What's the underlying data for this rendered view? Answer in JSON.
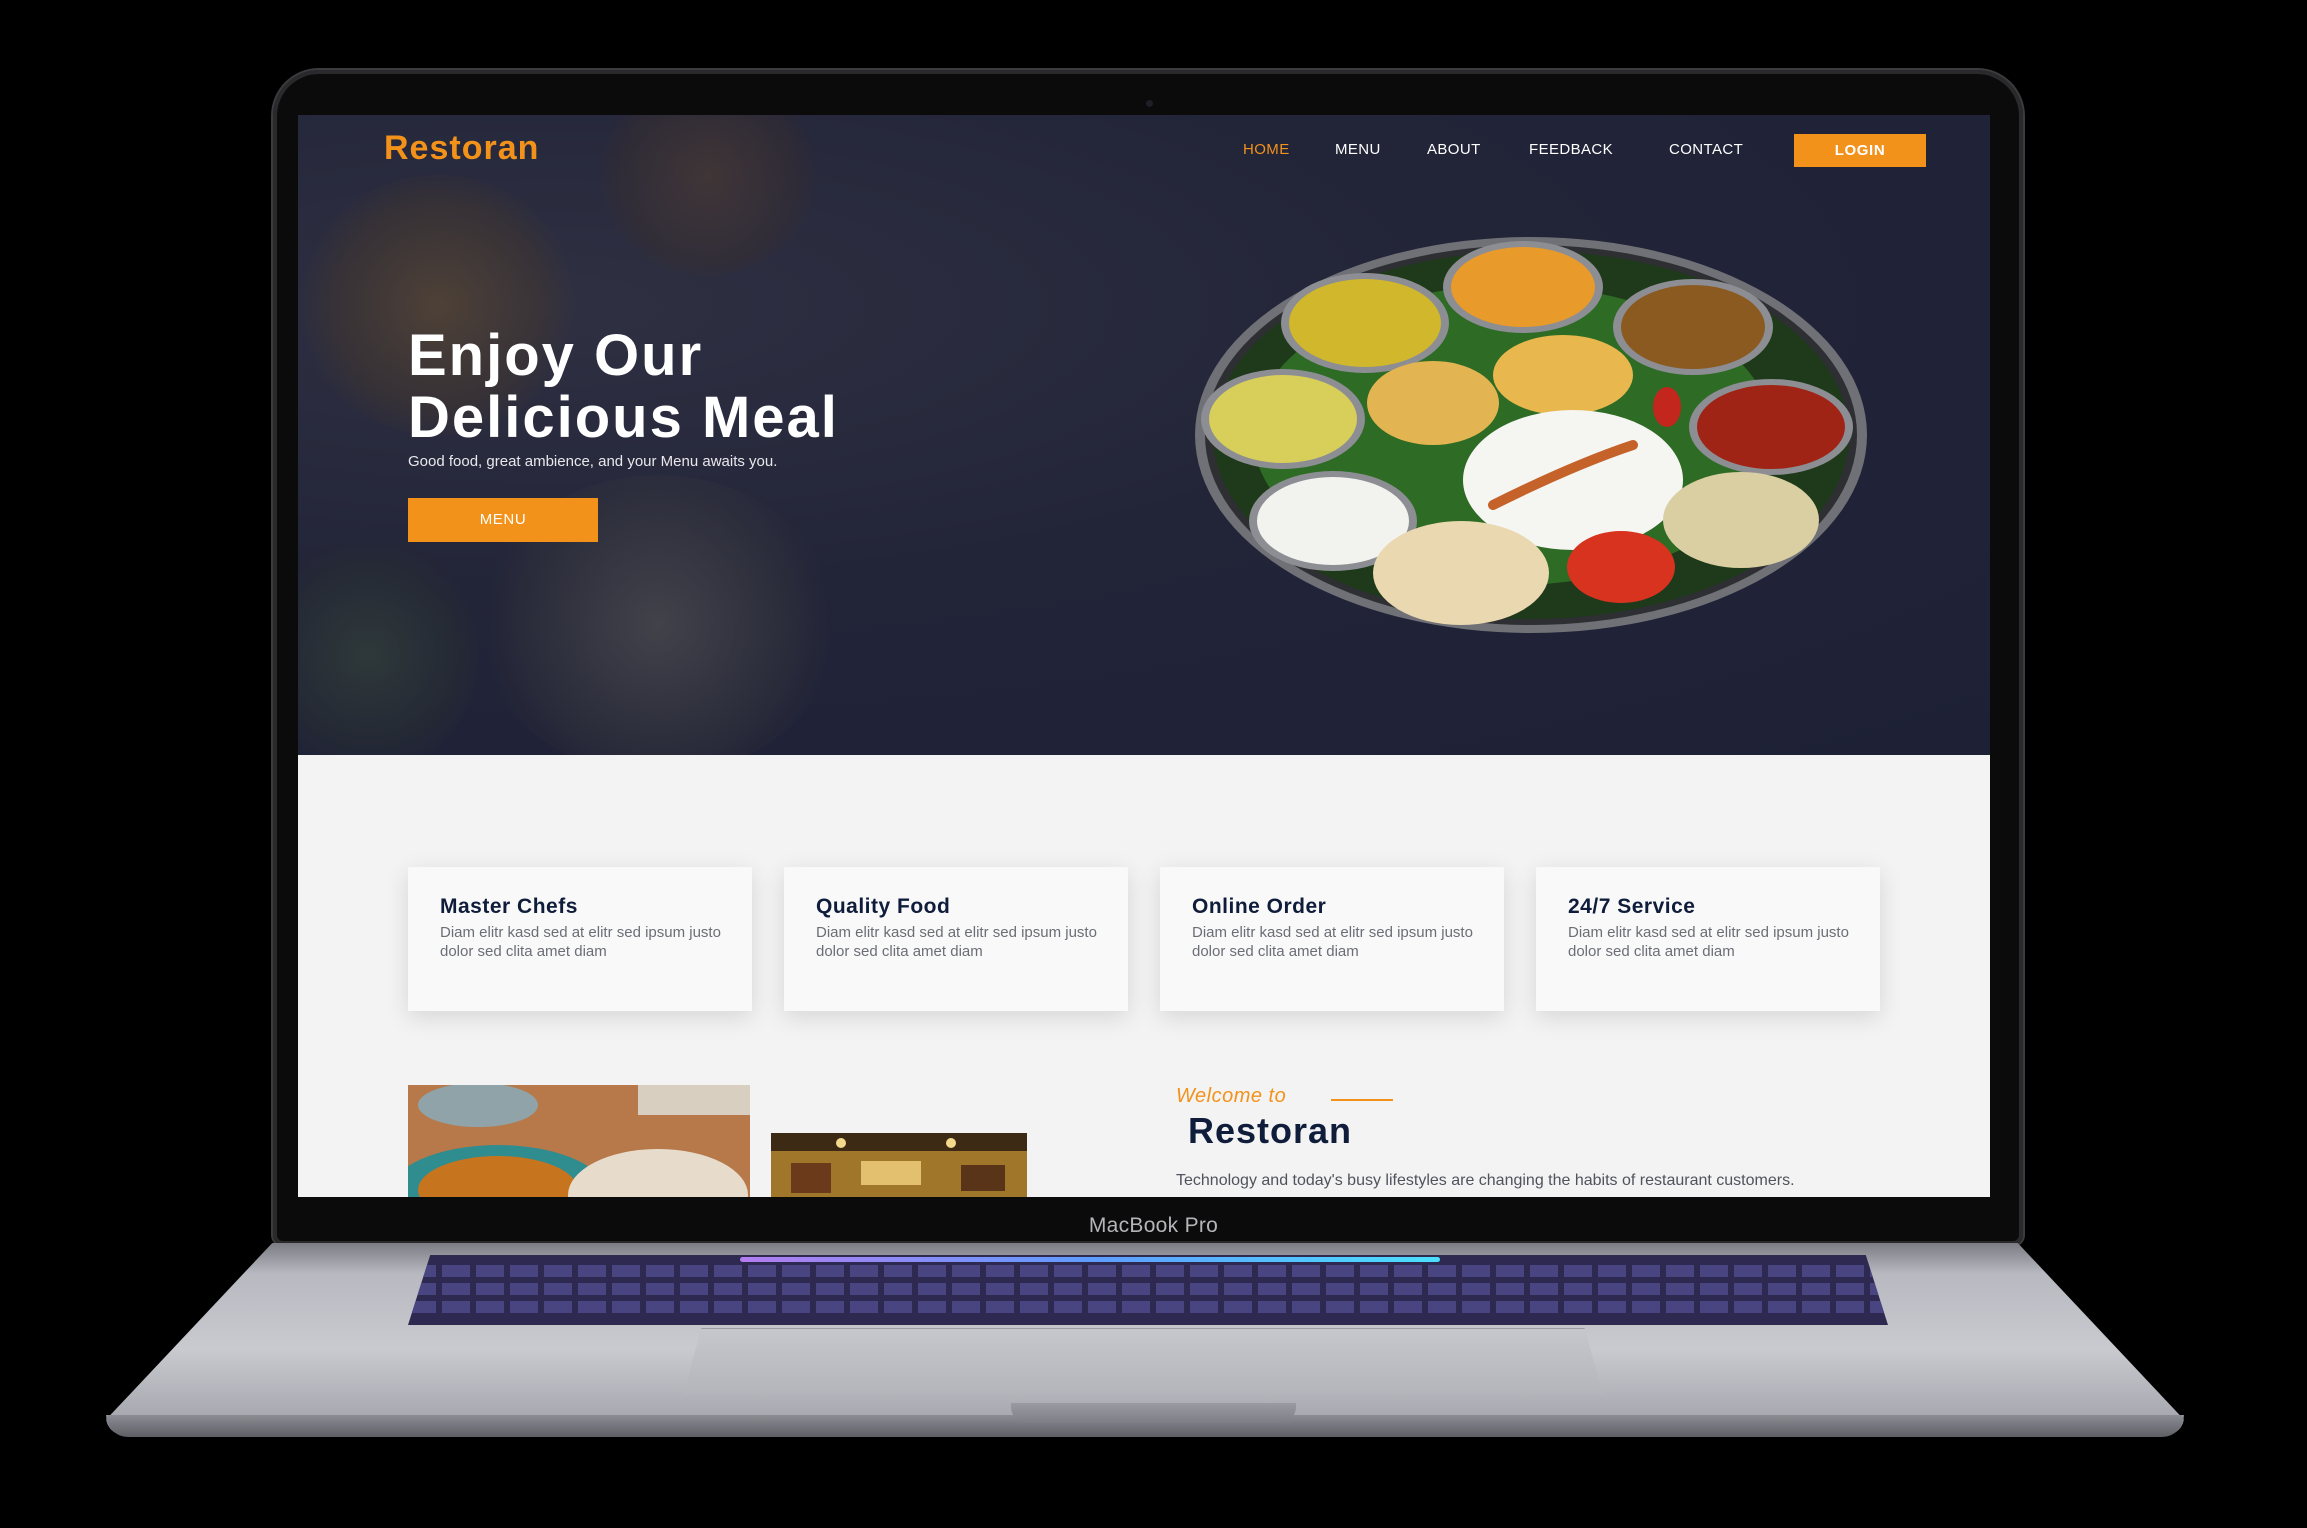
{
  "device": {
    "model_label": "MacBook Pro"
  },
  "site": {
    "logo": "Restoran",
    "nav": {
      "items": [
        "HOME",
        "MENU",
        "ABOUT",
        "FEEDBACK",
        "CONTACT"
      ],
      "active": "HOME",
      "login_label": "LOGIN"
    },
    "hero": {
      "title_line1": "Enjoy Our",
      "title_line2": "Delicious Meal",
      "subtitle": "Good food, great ambience, and your Menu awaits you.",
      "button_label": "MENU",
      "image": "thali-plate-image"
    },
    "features": [
      {
        "title": "Master Chefs",
        "text": "Diam elitr kasd sed at elitr sed ipsum justo dolor sed clita amet diam"
      },
      {
        "title": "Quality Food",
        "text": "Diam elitr kasd sed at elitr sed ipsum justo dolor sed clita amet diam"
      },
      {
        "title": "Online Order",
        "text": "Diam elitr kasd sed at elitr sed ipsum justo dolor sed clita amet diam"
      },
      {
        "title": "24/7 Service",
        "text": "Diam elitr kasd sed at elitr sed ipsum justo dolor sed clita amet diam"
      }
    ],
    "about": {
      "welcome": "Welcome to",
      "title": "Restoran",
      "text": "Technology and today's busy lifestyles are changing the habits of restaurant customers."
    }
  },
  "colors": {
    "accent": "#f2921b",
    "hero_bg": "#1e2136",
    "heading_dark": "#0f1d3b",
    "section_bg": "#f3f3f3"
  }
}
